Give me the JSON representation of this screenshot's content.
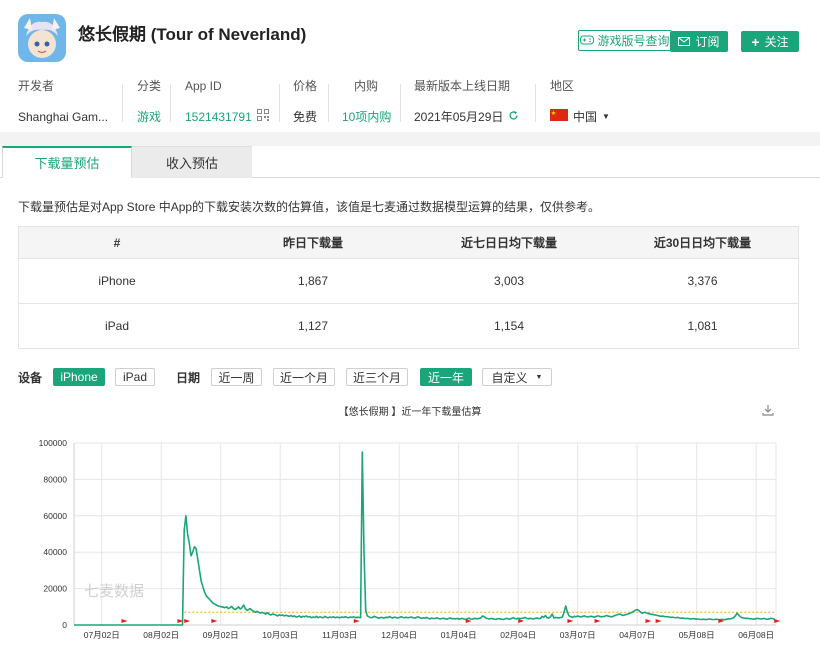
{
  "app": {
    "title": "悠长假期 (Tour of Neverland)",
    "version_query_label": "游戏版号查询",
    "subscribe_label": "订阅",
    "follow_label": "关注"
  },
  "meta": {
    "developer_label": "开发者",
    "developer_value": "Shanghai Gam...",
    "category_label": "分类",
    "category_value": "游戏",
    "appid_label": "App ID",
    "appid_value": "1521431791",
    "price_label": "价格",
    "price_value": "免费",
    "iap_label": "内购",
    "iap_value": "10项内购",
    "release_label": "最新版本上线日期",
    "release_value": "2021年05月29日",
    "region_label": "地区",
    "region_value": "中国"
  },
  "tabs": [
    {
      "label": "下载量预估",
      "active": true
    },
    {
      "label": "收入预估",
      "active": false
    }
  ],
  "description": "下载量预估是对App Store 中App的下载安装次数的估算值，该值是七麦通过数据模型运算的结果，仅供参考。",
  "table": {
    "headers": [
      "#",
      "昨日下载量",
      "近七日日均下载量",
      "近30日日均下载量"
    ],
    "rows": [
      [
        "iPhone",
        "1,867",
        "3,003",
        "3,376"
      ],
      [
        "iPad",
        "1,127",
        "1,154",
        "1,081"
      ]
    ]
  },
  "filters": {
    "device_label": "设备",
    "devices": [
      {
        "label": "iPhone",
        "active": true
      },
      {
        "label": "iPad",
        "active": false
      }
    ],
    "date_label": "日期",
    "ranges": [
      {
        "label": "近一周",
        "active": false
      },
      {
        "label": "近一个月",
        "active": false
      },
      {
        "label": "近三个月",
        "active": false
      },
      {
        "label": "近一年",
        "active": true
      },
      {
        "label": "自定义",
        "active": false
      }
    ]
  },
  "colors": {
    "accent": "#1aa57a",
    "line": "#1aa57a",
    "average_line": "#f5a623",
    "marker": "#e02020"
  },
  "chart_data": {
    "type": "line",
    "title": "【悠长假期 】近一年下载量估算",
    "watermark": "七麦数据",
    "ylim": [
      0,
      100000
    ],
    "yticks": [
      0,
      20000,
      40000,
      60000,
      80000,
      100000
    ],
    "xtick_labels": [
      "07月02日",
      "08月02日",
      "09月02日",
      "10月03日",
      "11月03日",
      "12月04日",
      "01月04日",
      "02月04日",
      "03月07日",
      "04月07日",
      "05月08日",
      "06月08日"
    ],
    "grid": true,
    "average_value": 7000,
    "marker_day_indices": [
      28,
      61,
      65,
      81,
      165,
      231,
      262,
      291,
      307,
      337,
      343,
      380,
      413
    ],
    "series": [
      {
        "values": [
          0,
          0,
          0,
          0,
          0,
          0,
          0,
          0,
          0,
          0,
          0,
          0,
          0,
          0,
          0,
          0,
          0,
          0,
          0,
          0,
          0,
          0,
          0,
          0,
          0,
          0,
          0,
          0,
          0,
          0,
          0,
          0,
          0,
          0,
          0,
          0,
          0,
          0,
          0,
          0,
          0,
          0,
          0,
          0,
          0,
          0,
          0,
          0,
          0,
          0,
          0,
          0,
          0,
          0,
          0,
          0,
          0,
          0,
          0,
          0,
          0,
          0,
          0,
          0,
          0,
          52000,
          60000,
          50000,
          45000,
          38000,
          40000,
          43000,
          42000,
          36000,
          30000,
          24000,
          21000,
          18000,
          16000,
          15000,
          14000,
          13000,
          12000,
          11500,
          11000,
          10500,
          10200,
          10000,
          9800,
          9500,
          10000,
          9000,
          9500,
          10200,
          9000,
          8500,
          9000,
          10000,
          8800,
          9500,
          11000,
          9000,
          8000,
          8500,
          9000,
          8000,
          7500,
          7000,
          7500,
          7000,
          6500,
          7000,
          6500,
          6000,
          6800,
          6000,
          5500,
          6000,
          5800,
          5500,
          5000,
          5600,
          5200,
          5500,
          5000,
          5400,
          5000,
          4800,
          5200,
          4600,
          5000,
          4400,
          4500,
          5000,
          4200,
          4800,
          4500,
          5000,
          4400,
          4600,
          4000,
          4400,
          4200,
          4800,
          4000,
          4500,
          4200,
          4000,
          4800,
          4200,
          4000,
          4400,
          4100,
          4500,
          4000,
          4300,
          4200,
          4000,
          4400,
          4100,
          4500,
          4200,
          4000,
          4400,
          4100,
          4500,
          4000,
          4300,
          4200,
          4000,
          95000,
          40000,
          8000,
          5000,
          4500,
          4000,
          4200,
          4800,
          4400,
          4000,
          3800,
          4200,
          4000,
          3800,
          4300,
          4000,
          4600,
          4200,
          3800,
          4400,
          4000,
          3900,
          4200,
          4500,
          4100,
          4000,
          4300,
          3900,
          4200,
          4400,
          4000,
          3800,
          4200,
          4500,
          4000,
          3600,
          4000,
          3800,
          4200,
          3600,
          3400,
          3800,
          3500,
          3600,
          4000,
          3500,
          3300,
          3600,
          3700,
          3400,
          3200,
          3600,
          3800,
          3400,
          3500,
          3300,
          3600,
          3200,
          3400,
          3600,
          3300,
          3100,
          3400,
          3800,
          3300,
          3200,
          3600,
          3500,
          3400,
          3600,
          4000,
          5000,
          4500,
          3800,
          3500,
          3300,
          3600,
          3400,
          3200,
          3100,
          3500,
          3400,
          3200,
          3000,
          3300,
          3600,
          3400,
          3200,
          3600,
          4000,
          3500,
          3400,
          3700,
          3500,
          3600,
          3800,
          4200,
          3600,
          3400,
          3700,
          3500,
          3300,
          3600,
          3800,
          3600,
          3500,
          4800,
          4200,
          5200,
          4000,
          3800,
          4500,
          6000,
          3800,
          4200,
          4000,
          3900,
          4100,
          4300,
          7000,
          10500,
          7000,
          5000,
          4500,
          4200,
          4800,
          4500,
          5000,
          4600,
          4400,
          4800,
          5000,
          4600,
          4400,
          4600,
          4800,
          4500,
          4300,
          4800,
          5000,
          4700,
          4500,
          4600,
          4800,
          5200,
          4900,
          4700,
          4500,
          4800,
          5200,
          5500,
          5800,
          6000,
          5500,
          5300,
          5600,
          5800,
          6200,
          6500,
          7000,
          7500,
          8000,
          8500,
          8000,
          7200,
          6500,
          6800,
          7000,
          6500,
          6200,
          6000,
          5800,
          5600,
          5500,
          5200,
          5000,
          4800,
          4900,
          4700,
          4500,
          4600,
          4400,
          4200,
          4300,
          4100,
          4000,
          4200,
          3900,
          3700,
          3800,
          3600,
          3500,
          3700,
          3400,
          3300,
          3500,
          3400,
          3200,
          3300,
          3100,
          3000,
          3200,
          3100,
          3000,
          3200,
          3300,
          3100,
          3000,
          3100,
          3200,
          3000,
          2900,
          3100,
          3000,
          2900,
          3200,
          3400,
          3300,
          3600,
          4000,
          5000,
          6500,
          5500,
          4500,
          4000,
          3800,
          3600,
          3700,
          3500,
          3400,
          3300,
          3200,
          3400,
          3600,
          3500,
          3300,
          3400,
          3600,
          3300,
          3100,
          3400,
          3600,
          3500,
          3200,
          2000
        ]
      }
    ]
  }
}
